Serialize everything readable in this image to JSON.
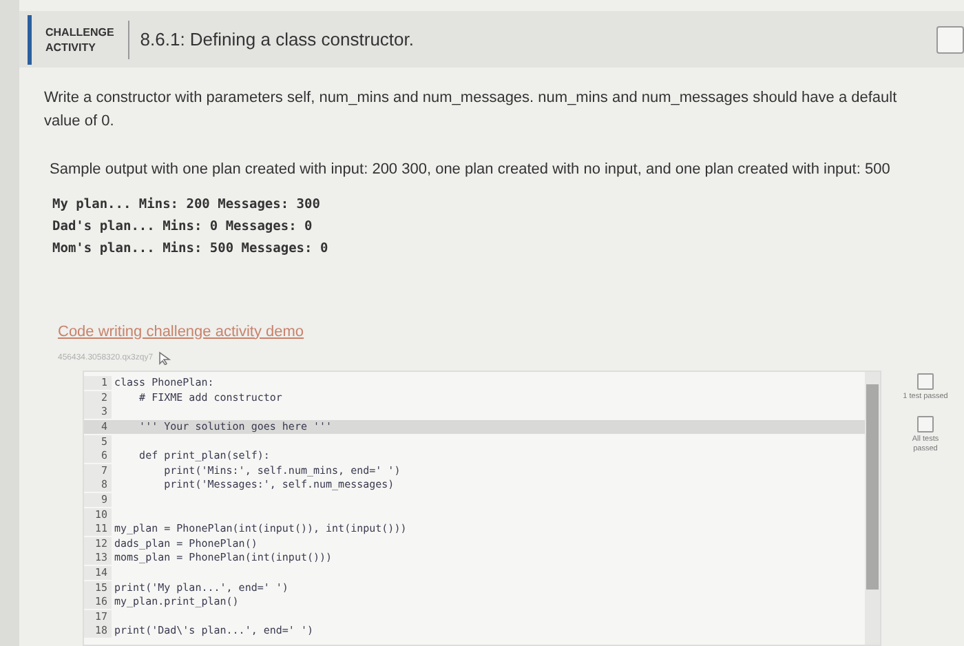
{
  "header": {
    "badge": [
      "CHALLENGE",
      "ACTIVITY"
    ],
    "title": "8.6.1: Defining a class constructor."
  },
  "instructions": "Write a constructor with parameters self, num_mins and num_messages. num_mins and num_messages should have a default value of 0.",
  "sample_intro": "Sample output with one plan created with input: 200 300, one plan created with no input, and one plan created with input: 500",
  "sample_output": [
    "My plan... Mins: 200 Messages: 300",
    "Dad's plan... Mins: 0 Messages: 0",
    "Mom's plan... Mins: 500 Messages: 0"
  ],
  "demo_link": "Code writing challenge activity demo",
  "activity_id": "456434.3058320.qx3zqy7",
  "code_lines": [
    {
      "number": "1",
      "text": "class PhonePlan:",
      "highlighted": false
    },
    {
      "number": "2",
      "text": "    # FIXME add constructor",
      "highlighted": false
    },
    {
      "number": "3",
      "highlighted": false
    },
    {
      "number": "4",
      "text": "    ''' Your solution goes here '''",
      "highlighted": true
    },
    {
      "number": "5",
      "highlighted": false
    },
    {
      "number": "6",
      "text": "    def print_plan(self):",
      "highlighted": false
    },
    {
      "number": "7",
      "text": "        print('Mins:', self.num_mins, end=' ')",
      "highlighted": false
    },
    {
      "number": "8",
      "text": "        print('Messages:', self.num_messages)",
      "highlighted": false
    },
    {
      "number": "9",
      "highlighted": false
    },
    {
      "number": "10",
      "highlighted": false
    },
    {
      "number": "11",
      "text": "my_plan = PhonePlan(int(input()), int(input()))",
      "highlighted": false
    },
    {
      "number": "12",
      "text": "dads_plan = PhonePlan()",
      "highlighted": false
    },
    {
      "number": "13",
      "text": "moms_plan = PhonePlan(int(input()))",
      "highlighted": false
    },
    {
      "number": "14",
      "highlighted": false
    },
    {
      "number": "15",
      "text": "print('My plan...', end=' ')",
      "highlighted": false
    },
    {
      "number": "16",
      "text": "my_plan.print_plan()",
      "highlighted": false
    },
    {
      "number": "17",
      "highlighted": false
    },
    {
      "number": "18",
      "text": "print('Dad\\'s plan...', end=' ')",
      "highlighted": false
    }
  ],
  "tests": [
    {
      "label": "1 test passed",
      "checked": false
    },
    {
      "label": "All tests passed",
      "checked": false
    }
  ]
}
